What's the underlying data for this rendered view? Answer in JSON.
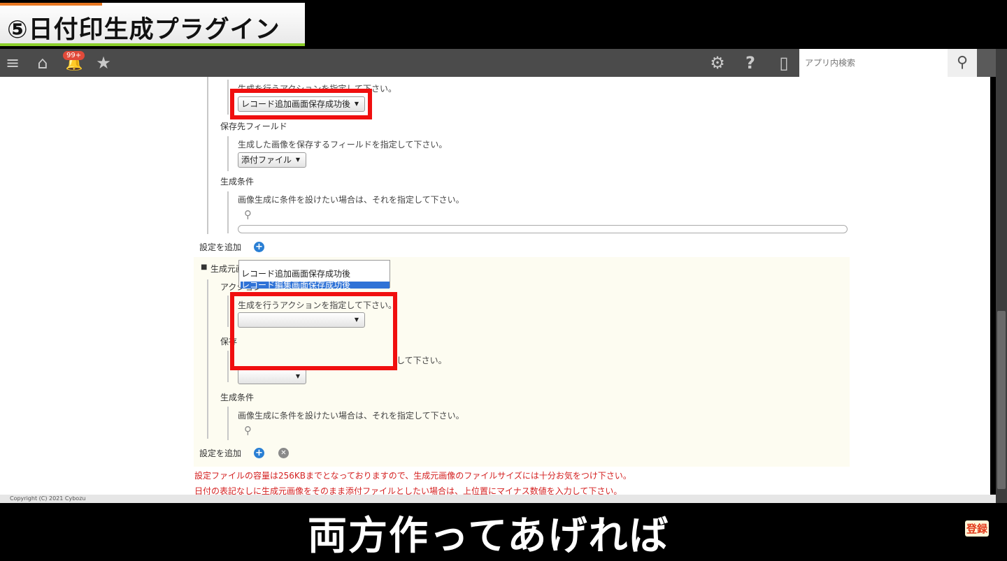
{
  "overlay": {
    "title": "⑤日付印生成プラグイン",
    "subtitle": "両方作ってあげれば",
    "subscribe": "登録"
  },
  "header": {
    "menu_icon": "≡",
    "home_icon": "⌂",
    "bell_icon": "🔔",
    "notification_count": "99+",
    "star_icon": "★",
    "gear_icon": "⚙",
    "help_icon": "?",
    "mobile_icon": "▯",
    "search_placeholder": "アプリ内検索",
    "search_icon": "⚲"
  },
  "section1": {
    "action_desc": "生成を行うアクションを指定して下さい。",
    "action_select": "レコード追加画面保存成功後",
    "save_field_label": "保存先フィールド",
    "save_field_desc": "生成した画像を保存するフィールドを指定して下さい。",
    "save_field_select": "添付ファイル",
    "condition_label": "生成条件",
    "condition_desc": "画像生成に条件を設けたい場合は、それを指定して下さい。",
    "add_setting": "設定を追加"
  },
  "section2": {
    "heading_bullet": "■",
    "heading": "生成元画像",
    "action_label": "アクション",
    "action_desc": "生成を行うアクションを指定して下さい。",
    "action_select": "",
    "save_field_label_partial": "保存",
    "save_field_desc_partial": "して下さい。",
    "save_field_select": "",
    "dropdown_options": [
      "レコード追加画面保存成功後",
      "レコード編集画面保存成功後"
    ],
    "dropdown_selected_index": 1,
    "condition_label": "生成条件",
    "condition_desc": "画像生成に条件を設けたい場合は、それを指定して下さい。",
    "add_setting": "設定を追加"
  },
  "notes": [
    "設定ファイルの容量は256KBまでとなっておりますので、生成元画像のファイルサイズには十分お気をつけ下さい。",
    "日付の表記なしに生成元画像をそのまま添付ファイルとしたい場合は、上位置にマイナス数値を入力して下さい。"
  ],
  "footer": {
    "copyright": "Copyright (C) 2021 Cybozu"
  },
  "colors": {
    "header_bg": "#4b4b4b",
    "highlight_red": "#f00f0f",
    "selection_blue": "#2f72d6",
    "warning_red": "#d42020",
    "accent_green": "#8ccf2a"
  }
}
